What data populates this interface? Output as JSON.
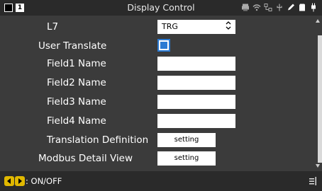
{
  "window": {
    "title": "Display Control",
    "tab_number": "1"
  },
  "status_icons": [
    "printer-icon",
    "wifi-icon",
    "network-icon",
    "usb-icon",
    "pen-icon",
    "sd-card-icon",
    "power-plug-icon"
  ],
  "rows": [
    {
      "label": "L7",
      "type": "select",
      "value": "TRG"
    },
    {
      "label": "User Translate",
      "type": "checkbox",
      "checked": true
    },
    {
      "label": "Field1 Name",
      "type": "text",
      "value": ""
    },
    {
      "label": "Field2 Name",
      "type": "text",
      "value": ""
    },
    {
      "label": "Field3 Name",
      "type": "text",
      "value": ""
    },
    {
      "label": "Field4 Name",
      "type": "text",
      "value": ""
    },
    {
      "label": "Translation Definition",
      "type": "button",
      "button_label": "setting"
    },
    {
      "label": "Modbus Detail View",
      "type": "button",
      "button_label": "setting"
    }
  ],
  "footer": {
    "hint": ": ON/OFF"
  },
  "colors": {
    "accent": "#2a7ad3",
    "arrow_button": "#e0b800",
    "background": "#3b3b3b"
  }
}
